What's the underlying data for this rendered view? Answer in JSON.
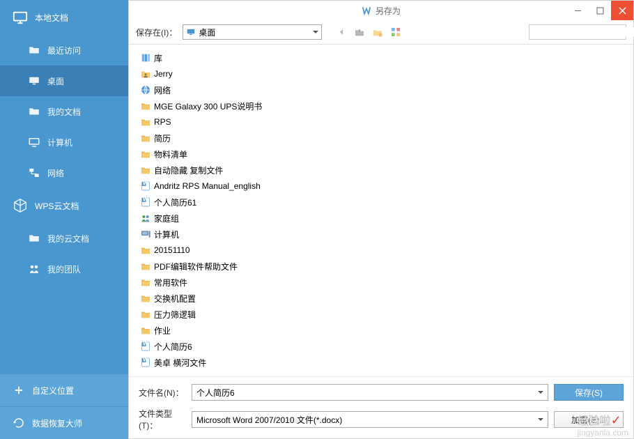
{
  "sidebar": {
    "header1": "本地文档",
    "items": [
      {
        "label": "最近访问"
      },
      {
        "label": "桌面"
      },
      {
        "label": "我的文档"
      },
      {
        "label": "计算机"
      },
      {
        "label": "网络"
      }
    ],
    "header2": "WPS云文档",
    "cloudItems": [
      {
        "label": "我的云文档"
      },
      {
        "label": "我的团队"
      }
    ],
    "bottom": [
      {
        "label": "自定义位置"
      },
      {
        "label": "数据恢复大师"
      }
    ]
  },
  "titlebar": {
    "title": "另存为"
  },
  "toolbar": {
    "saveInLabel": "保存在(I)：",
    "location": "桌面"
  },
  "files": [
    {
      "name": "库",
      "icon": "lib"
    },
    {
      "name": "Jerry",
      "icon": "user"
    },
    {
      "name": "网络",
      "icon": "globe"
    },
    {
      "name": "MGE Galaxy 300 UPS说明书",
      "icon": "folder"
    },
    {
      "name": "RPS",
      "icon": "folder"
    },
    {
      "name": "简历",
      "icon": "folder"
    },
    {
      "name": "物料清单",
      "icon": "folder"
    },
    {
      "name": "自动隐藏 复制文件",
      "icon": "folder"
    },
    {
      "name": "Andritz RPS Manual_english",
      "icon": "doc"
    },
    {
      "name": "个人简历61",
      "icon": "doc"
    },
    {
      "name": "家庭组",
      "icon": "group"
    },
    {
      "name": "计算机",
      "icon": "pc"
    },
    {
      "name": "20151110",
      "icon": "folder"
    },
    {
      "name": "PDF编辑软件帮助文件",
      "icon": "folder"
    },
    {
      "name": "常用软件",
      "icon": "folder"
    },
    {
      "name": "交换机配置",
      "icon": "folder"
    },
    {
      "name": "压力筛逻辑",
      "icon": "folder"
    },
    {
      "name": "作业",
      "icon": "folder"
    },
    {
      "name": "个人简历6",
      "icon": "doc"
    },
    {
      "name": "美卓 横河文件",
      "icon": "doc"
    }
  ],
  "footer": {
    "filenameLabel": "文件名(N)：",
    "filenameValue": "个人简历6",
    "filetypeLabel": "文件类型(T)：",
    "filetypeValue": "Microsoft Word 2007/2010 文件(*.docx)",
    "saveBtn": "保存(S)",
    "encryptBtn": "加密(E)..."
  },
  "watermark": {
    "main": "经验啦",
    "sub": "jingyanla.com"
  }
}
